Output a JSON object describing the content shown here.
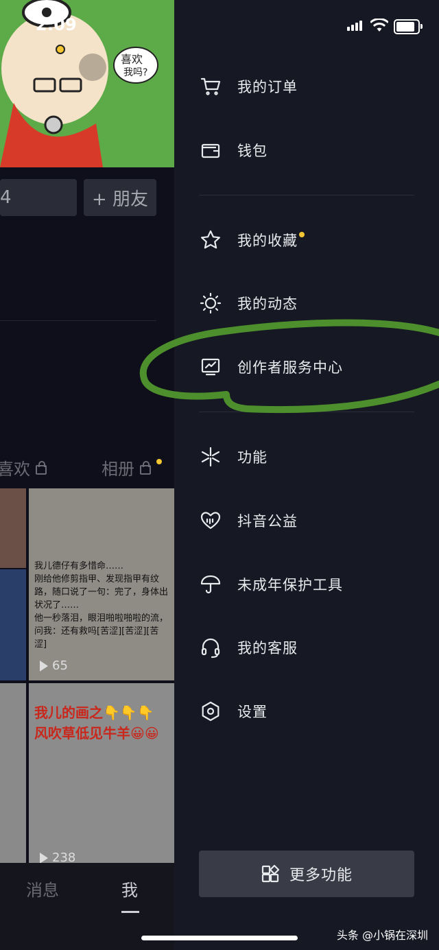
{
  "status_bar": {
    "time": "2:09"
  },
  "profile_bg": {
    "add_friend": "+ 朋友",
    "tabs": [
      {
        "label": "喜欢"
      },
      {
        "label": "相册"
      }
    ],
    "videos": [
      {
        "caption": "我儿德仔有多惜命……\n刚给他修剪指甲、发现指甲有纹路，随口说了一句：完了，身体出状况了……\n他一秒落泪，眼泪啪啦啪啦的流，问我：还有救吗[苦涩][苦涩][苦涩]",
        "plays": "65"
      },
      {
        "caption": "我儿的画之👇👇👇\n风吹草低见牛羊😀😀",
        "plays": "238"
      }
    ],
    "bottom_nav": [
      {
        "label": "消息"
      },
      {
        "label": "我"
      }
    ]
  },
  "drawer": {
    "items": [
      {
        "label": "我的订单",
        "icon": "cart-icon"
      },
      {
        "label": "钱包",
        "icon": "wallet-icon"
      },
      {
        "label": "我的收藏",
        "icon": "star-icon",
        "badge_dot": true
      },
      {
        "label": "我的动态",
        "icon": "sun-icon"
      },
      {
        "label": "创作者服务中心",
        "icon": "monitor-chart-icon"
      },
      {
        "label": "功能",
        "icon": "sparkle-icon"
      },
      {
        "label": "抖音公益",
        "icon": "heart-rain-icon"
      },
      {
        "label": "未成年保护工具",
        "icon": "umbrella-icon"
      },
      {
        "label": "我的客服",
        "icon": "headset-icon"
      },
      {
        "label": "设置",
        "icon": "hex-gear-icon"
      }
    ],
    "more_button": {
      "label": "更多功能",
      "icon": "grid-icon"
    }
  },
  "watermark": "头条 @小锅在深圳",
  "colors": {
    "drawer_bg": "#161823",
    "accent_dot": "#f5c633",
    "annotation_green": "#4c8f2c"
  }
}
